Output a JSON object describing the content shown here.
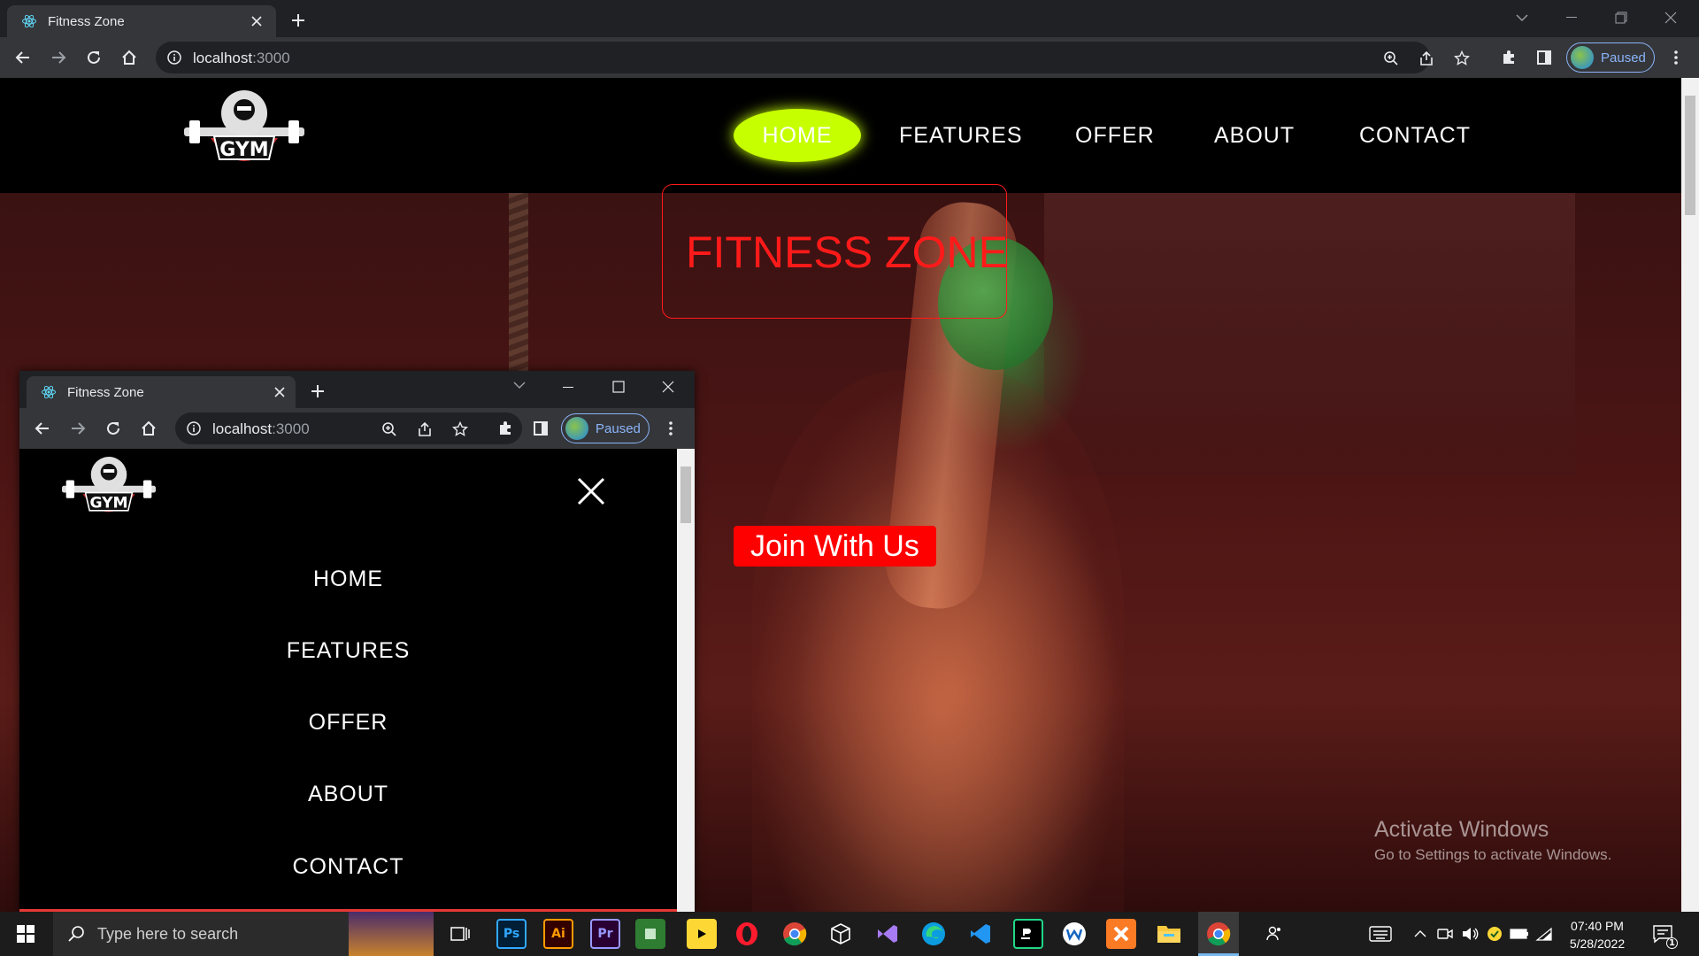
{
  "browser": {
    "tab_title": "Fitness Zone",
    "url_host": "localhost",
    "url_port": ":3000",
    "profile_label": "Paused"
  },
  "site": {
    "logo_text": "GYM",
    "nav": [
      "HOME",
      "FEATURES",
      "OFFER",
      "ABOUT",
      "CONTACT"
    ],
    "active_nav": "HOME",
    "hero_title": "FITNESS ZONE",
    "cta_label": "Join With Us",
    "colors": {
      "accent": "#c6ff00",
      "title_red": "#ff1a1a",
      "cta_red": "#ff0000"
    }
  },
  "watermark": {
    "line1": "Activate Windows",
    "line2": "Go to Settings to activate Windows."
  },
  "overlay_window": {
    "tab_title": "Fitness Zone",
    "url_host": "localhost",
    "url_port": ":3000",
    "profile_label": "Paused",
    "logo_text": "GYM",
    "menu": [
      "HOME",
      "FEATURES",
      "OFFER",
      "ABOUT",
      "CONTACT"
    ]
  },
  "taskbar": {
    "search_placeholder": "Type here to search",
    "apps": [
      "Ps",
      "Ai",
      "Pr"
    ],
    "time": "07:40 PM",
    "date": "5/28/2022",
    "notification_count": "1"
  }
}
